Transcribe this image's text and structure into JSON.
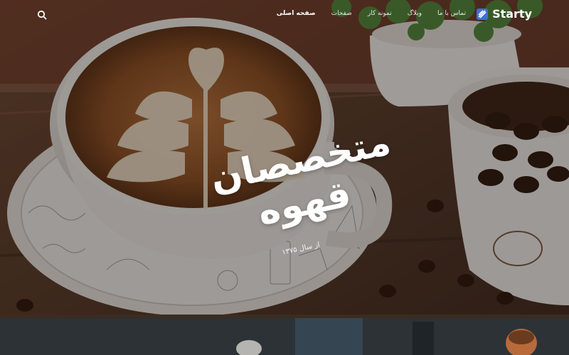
{
  "brand": {
    "name": "Starty",
    "icon": "starty-logo-icon",
    "accent": "#4a7bdc"
  },
  "nav": {
    "items": [
      {
        "label": "صفحه اصلی",
        "active": true
      },
      {
        "label": "صفحات",
        "active": false
      },
      {
        "label": "نمونه کار",
        "active": false
      },
      {
        "label": "وبلاگ",
        "active": false
      },
      {
        "label": "تماس با ما",
        "active": false
      }
    ],
    "search_icon": "search-icon"
  },
  "hero": {
    "headline_line1": "متخصصان",
    "headline_line2": "قهوه",
    "subtitle": "از سال ۱۳۷۵"
  }
}
